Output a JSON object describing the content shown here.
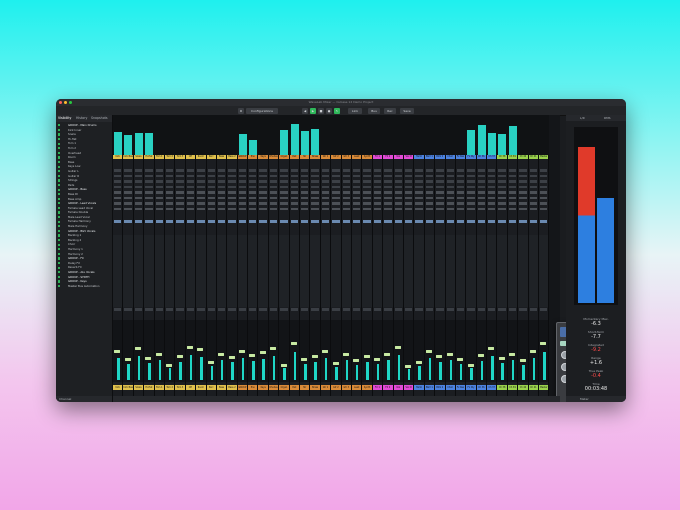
{
  "window": {
    "title": "WaveLab Mixer — Cubase 12 Demo Project",
    "traffic_lights": [
      "#ff5f57",
      "#febc2e",
      "#28c840"
    ]
  },
  "toolbar": {
    "configurations": "Configurations",
    "items": [
      "Link",
      "Bus",
      "Rec",
      "Save"
    ]
  },
  "left_panel": {
    "tabs": [
      "Visibility",
      "History",
      "Snapshots"
    ],
    "tracks": [
      "GROUP - Main Drums",
      "Kick Inner",
      "Snare",
      "Hi-Hat",
      "Tom 1",
      "Tom 2",
      "Overhead",
      "Room",
      "Bass",
      "Keys Low",
      "Guitar L",
      "Guitar R",
      "Strings",
      "Pads",
      "GROUP - Bass",
      "Bass DI",
      "Bass Amp",
      "GROUP - Lead Vocals",
      "Female Lead Vocal",
      "Female Double",
      "Male Lead Vocal",
      "Female Harmony",
      "Male Harmony",
      "GROUP - BGV Vocals",
      "Backing 1",
      "Backing 2",
      "Choir",
      "Harmony 1",
      "Harmony 2",
      "GROUP - FX",
      "Delay FX",
      "Reverb FX",
      "GROUP - ALL Vocals",
      "GROUP - SYNTH",
      "GROUP - Keys",
      "Master Bus Automation"
    ],
    "footer": "Channel"
  },
  "mixer": {
    "names": [
      "Kick",
      "Kick Bass",
      "Snare",
      "Hi-Hat",
      "Tom 1",
      "Tom 2",
      "Tom 3",
      "OH",
      "Room",
      "Perc",
      "Bass",
      "Bass 2",
      "GROUP",
      "Pno",
      "Keys",
      "Rhodes",
      "Organ",
      "Pad",
      "Str",
      "Brass",
      "Gtr 1",
      "Gtr 2",
      "Gtr 3",
      "Lead",
      "Synth",
      "FX 1",
      "FX 2",
      "Vox",
      "Vox D",
      "Harm",
      "BGV 1",
      "BGV 2",
      "Choir",
      "Fx Rev",
      "Fx Dly",
      "Ch 36",
      "Ch 37",
      "Ch 38",
      "Ch 39",
      "Ch 40",
      "Ch 41",
      "Master"
    ],
    "colors": [
      "#e0c04c",
      "#e0c04c",
      "#e0c04c",
      "#e0c04c",
      "#e0c04c",
      "#e0c04c",
      "#e0c04c",
      "#e0c04c",
      "#e0c04c",
      "#e0c04c",
      "#e0c04c",
      "#e0c04c",
      "#d98a38",
      "#d98a38",
      "#d98a38",
      "#d98a38",
      "#d98a38",
      "#d98a38",
      "#d98a38",
      "#d98a38",
      "#d98a38",
      "#d98a38",
      "#d98a38",
      "#d98a38",
      "#d98a38",
      "#e24ad6",
      "#e24ad6",
      "#e24ad6",
      "#e24ad6",
      "#4c82e0",
      "#4c82e0",
      "#4c82e0",
      "#4c82e0",
      "#4c82e0",
      "#4c82e0",
      "#4c82e0",
      "#4c82e0",
      "#9ad24c",
      "#9ad24c",
      "#9ad24c",
      "#9ad24c",
      "#9ad24c"
    ],
    "top_meter_levels": [
      0.65,
      0.55,
      0.6,
      0.6,
      0,
      0,
      0,
      0,
      0,
      0,
      0,
      0,
      0.58,
      0.42,
      0,
      0,
      0.7,
      0.85,
      0.68,
      0.72,
      0,
      0,
      0,
      0,
      0,
      0,
      0,
      0,
      0,
      0,
      0,
      0,
      0,
      0,
      0.7,
      0.82,
      0.62,
      0.58,
      0.8,
      0,
      0,
      0
    ],
    "fader_levels": [
      0.55,
      0.4,
      0.6,
      0.42,
      0.5,
      0.3,
      0.45,
      0.62,
      0.58,
      0.35,
      0.5,
      0.44,
      0.55,
      0.48,
      0.52,
      0.6,
      0.3,
      0.7,
      0.4,
      0.46,
      0.55,
      0.33,
      0.5,
      0.38,
      0.45,
      0.4,
      0.5,
      0.62,
      0.28,
      0.35,
      0.55,
      0.45,
      0.5,
      0.4,
      0.3,
      0.48,
      0.6,
      0.42,
      0.5,
      0.38,
      0.55,
      0.7
    ]
  },
  "master_section": {
    "tabs": [
      "L/R",
      "RMS"
    ],
    "readouts": [
      {
        "label": "Momentary Max.",
        "value": "-6.3",
        "red": false
      },
      {
        "label": "Short-Term",
        "value": "-7.7",
        "red": false
      },
      {
        "label": "Integrated",
        "value": "-9.2",
        "red": true
      },
      {
        "label": "Range",
        "value": "+1.6",
        "red": false
      },
      {
        "label": "True Peak",
        "value": "-0.4",
        "red": true
      },
      {
        "label": "Time",
        "value": "00:03:48",
        "red": false
      }
    ],
    "footer": "Meter",
    "meter_left_level": 0.92,
    "meter_right_level": 0.62
  },
  "colors": {
    "accent_green": "#2fb85a",
    "meter_cyan": "#29d1c2"
  }
}
